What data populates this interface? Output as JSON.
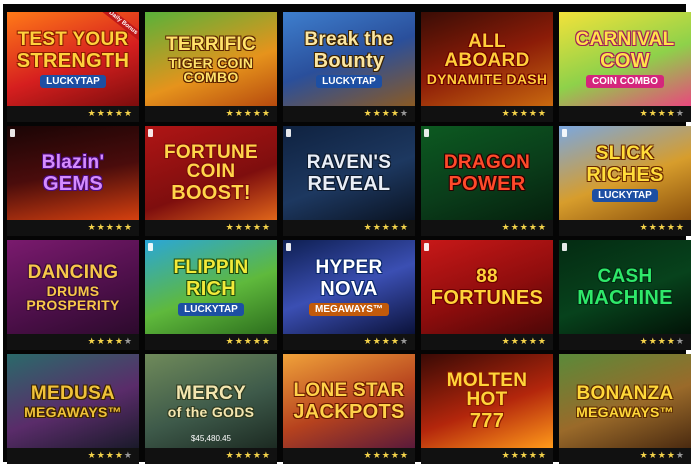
{
  "stars": "★★★★★",
  "games": [
    {
      "line1": "TEST YOUR",
      "line2": "STRENGTH",
      "sub": "LUCKYTAP",
      "sub_bg": "#1d4fa3",
      "color": "#ffd23d",
      "shadow": "#8a1a00",
      "bg": "linear-gradient(160deg,#ff7a18 0%,#d61f1f 55%,#7c0d0d 100%)",
      "badge": "Daily Bonus",
      "badge_bg": "#c01818",
      "badge_color": "#fff",
      "rating": 5,
      "info": false
    },
    {
      "line1": "TERRIFIC",
      "line2": "TIGER COIN COMBO",
      "sub": "",
      "color": "#ffe36a",
      "shadow": "#5a2200",
      "bg": "linear-gradient(160deg,#58b23a 0%,#e6931c 60%,#b64a0e 100%)",
      "badge": "",
      "badge_bg": "#ffd400",
      "badge_color": "#222",
      "rating": 5,
      "info": false
    },
    {
      "line1": "Break the",
      "line2": "Bounty",
      "sub": "LUCKYTAP",
      "sub_bg": "#1d4fa3",
      "color": "#fbe6a2",
      "shadow": "#3a2200",
      "bg": "linear-gradient(160deg,#3e7fce 0%,#2a4f9b 50%,#8a5a24 100%)",
      "badge": "",
      "rating": 4,
      "info": false
    },
    {
      "line1": "ALL ABOARD",
      "line2": "DYNAMITE DASH",
      "sub": "",
      "color": "#ffce3a",
      "shadow": "#6b0000",
      "bg": "linear-gradient(160deg,#3a0d05 0%,#8c1c08 50%,#c9690f 100%)",
      "badge": "",
      "rating": 5,
      "info": false
    },
    {
      "line1": "CARNIVAL",
      "line2": "COW",
      "sub": "COIN COMBO",
      "sub_bg": "#d4267c",
      "color": "#ffe24a",
      "shadow": "#a01e5a",
      "bg": "linear-gradient(160deg,#f3e23a 0%,#8ed14a 55%,#e9477d 100%)",
      "badge": "",
      "rating": 4,
      "info": false
    },
    {
      "line1": "Blazin'",
      "line2": "GEMS",
      "sub": "",
      "color": "#d58cff",
      "shadow": "#4b0a7a",
      "bg": "linear-gradient(170deg,#1a0505 0%,#4a0c0c 50%,#d5400f 100%)",
      "badge": "",
      "rating": 5,
      "info": true
    },
    {
      "line1": "FORTUNE COIN",
      "line2": "BOOST!",
      "sub": "",
      "color": "#ffd54a",
      "shadow": "#7a0a0a",
      "bg": "linear-gradient(160deg,#b01515 0%,#7e0e0e 60%,#e0661a 100%)",
      "badge": "",
      "rating": 5,
      "info": true
    },
    {
      "line1": "RAVEN'S",
      "line2": "REVEAL",
      "sub": "",
      "color": "#e9eef7",
      "shadow": "#0d1a2e",
      "bg": "linear-gradient(160deg,#0f2240 0%,#1d3860 55%,#0a1322 100%)",
      "badge": "",
      "rating": 5,
      "info": true
    },
    {
      "line1": "DRAGON",
      "line2": "POWER",
      "sub": "",
      "color": "#ff4a2a",
      "shadow": "#2a0000",
      "bg": "linear-gradient(160deg,#0c5a21 0%,#0a3d1a 55%,#05200d 100%)",
      "badge": "",
      "rating": 5,
      "info": true
    },
    {
      "line1": "SLICK",
      "line2": "RICHES",
      "sub": "LUCKYTAP",
      "sub_bg": "#1d4fa3",
      "color": "#ffde3b",
      "shadow": "#6a2800",
      "bg": "linear-gradient(160deg,#7aa7e0 0%,#d79d2c 55%,#8a4f0c 100%)",
      "badge": "",
      "rating": 5,
      "info": true
    },
    {
      "line1": "DANCING",
      "line2": "DRUMS PROSPERITY",
      "sub": "",
      "color": "#f7c84a",
      "shadow": "#3a0a35",
      "bg": "linear-gradient(160deg,#7a1a6e 0%,#4b0f48 60%,#2c0a2c 100%)",
      "badge": "",
      "rating": 4,
      "info": false
    },
    {
      "line1": "FLIPPIN",
      "line2": "RICH",
      "sub": "LUCKYTAP",
      "sub_bg": "#1d4fa3",
      "color": "#f2ea3a",
      "shadow": "#1e4a0a",
      "bg": "linear-gradient(160deg,#2aa6d8 0%,#5fb93c 55%,#2d6f1e 100%)",
      "badge": "",
      "rating": 5,
      "info": true
    },
    {
      "line1": "HYPER",
      "line2": "NOVA",
      "sub": "MEGAWAYS™",
      "sub_bg": "#c25a0a",
      "color": "#ffffff",
      "shadow": "#0c2a6e",
      "bg": "linear-gradient(160deg,#0e1f52 0%,#3b4fb3 50%,#0b123a 100%)",
      "badge": "",
      "rating": 4,
      "info": true
    },
    {
      "line1": "88",
      "line2": "FORTUNES",
      "sub": "",
      "color": "#ffd43a",
      "shadow": "#6a0000",
      "bg": "linear-gradient(160deg,#c81818 0%,#8e0d0d 55%,#4d0707 100%)",
      "badge": "",
      "rating": 5,
      "info": true
    },
    {
      "line1": "CASH",
      "line2": "MACHINE",
      "sub": "",
      "color": "#2fe86a",
      "shadow": "#002a10",
      "bg": "linear-gradient(160deg,#042b12 0%,#07421c 55%,#021307 100%)",
      "badge": "",
      "rating": 4,
      "info": true
    },
    {
      "line1": "MEDUSA",
      "line2": "MEGAWAYS™",
      "sub": "",
      "color": "#f0c23a",
      "shadow": "#3a2200",
      "bg": "linear-gradient(160deg,#2a6a6a 0%,#5a2c6a 55%,#1a1a2a 100%)",
      "badge": "",
      "rating": 4,
      "info": false
    },
    {
      "line1": "MERCY",
      "line2": "of the GODS",
      "sub": "",
      "color": "#f4e6b0",
      "shadow": "#2e3a20",
      "bg": "linear-gradient(160deg,#6f8a5a 0%,#3e5a4a 55%,#1c2a22 100%)",
      "badge": "",
      "rating": 5,
      "info": false,
      "jackpot": "$45,480.45"
    },
    {
      "line1": "LONE STAR",
      "line2": "JACKPOTS",
      "sub": "",
      "color": "#ffd24a",
      "shadow": "#6a1a00",
      "bg": "linear-gradient(160deg,#f0a23a 0%,#b6421e 55%,#5a1a3a 100%)",
      "badge": "",
      "rating": 5,
      "info": false
    },
    {
      "line1": "MOLTEN HOT",
      "line2": "777",
      "sub": "",
      "color": "#ffd43a",
      "shadow": "#8a1a00",
      "bg": "linear-gradient(160deg,#3a0a05 0%,#b3260c 55%,#ff9a1a 100%)",
      "badge": "",
      "rating": 5,
      "info": false
    },
    {
      "line1": "BONANZA",
      "line2": "MEGAWAYS™",
      "sub": "",
      "color": "#ffd83a",
      "shadow": "#5a2a00",
      "bg": "linear-gradient(160deg,#5a8a3a 0%,#9a6a2a 55%,#4a2a10 100%)",
      "badge": "",
      "rating": 4,
      "info": false
    }
  ]
}
